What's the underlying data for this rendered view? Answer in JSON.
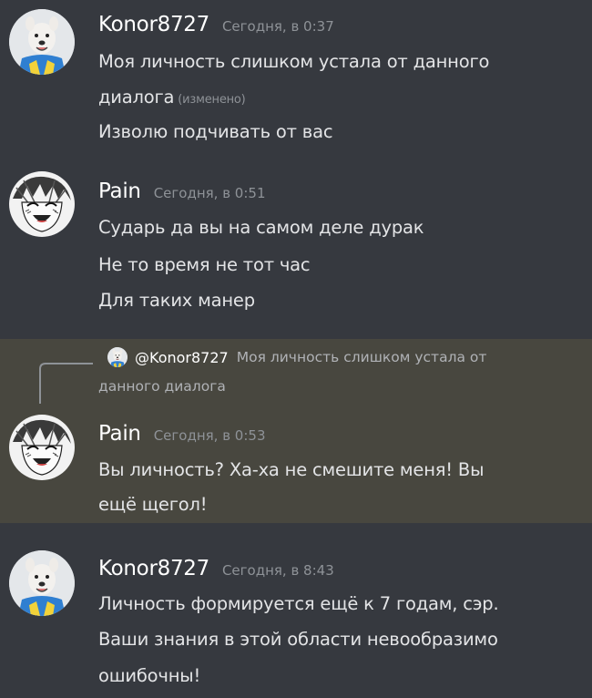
{
  "colors": {
    "background": "#36393f",
    "highlight": "#48473f",
    "username": "#ffffff",
    "timestamp": "#8e9297",
    "message_text": "#e3e4e6"
  },
  "messages": [
    {
      "author": "Konor8727",
      "avatar_icon": "dog-avatar-icon",
      "timestamp": "Сегодня, в 0:37",
      "lines": [
        "Моя личность слишком устала от данного",
        "диалога",
        "Изволю подчивать от вас"
      ],
      "edited_label": "(изменено)"
    },
    {
      "author": "Pain",
      "avatar_icon": "anime-avatar-icon",
      "timestamp": "Сегодня, в 0:51",
      "lines": [
        "Сударь да вы на самом деле дурак",
        "Не то время не тот час",
        "Для таких манер"
      ]
    },
    {
      "author": "Pain",
      "avatar_icon": "anime-avatar-icon",
      "timestamp": "Сегодня, в 0:53",
      "reply": {
        "author": "@Konor8727",
        "text_line1": "Моя личность слишком устала от",
        "text_line2": "данного диалога"
      },
      "lines": [
        "Вы личность? Ха-ха не смешите меня! Вы",
        "ещё щегол!"
      ]
    },
    {
      "author": "Konor8727",
      "avatar_icon": "dog-avatar-icon",
      "timestamp": "Сегодня, в 8:43",
      "lines": [
        "Личность формируется ещё к 7 годам, сэр.",
        "Ваши знания в этой области невообразимо",
        "ошибочны!"
      ]
    }
  ]
}
